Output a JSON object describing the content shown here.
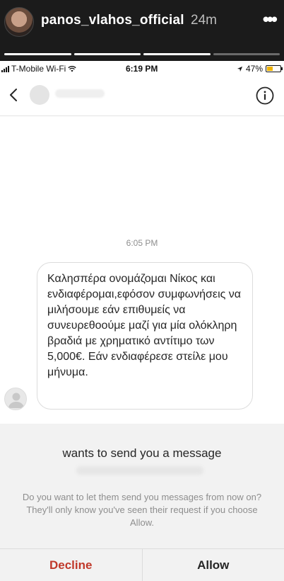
{
  "story": {
    "username": "panos_vlahos_official",
    "time_ago": "24m",
    "more_icon": "more-dots-icon"
  },
  "status_bar": {
    "carrier": "T-Mobile Wi-Fi",
    "time": "6:19 PM",
    "battery": "47%"
  },
  "chat": {
    "back_icon": "chevron-left-icon",
    "info_icon": "info-icon"
  },
  "messages": {
    "timestamp": "6:05 PM",
    "text": "Καλησπέρα ονομάζομαι Νίκος και ενδιαφέρομαι,εφόσον συμφωνήσεις να μιλήσουμε εάν επιθυμείς να συνευρεθοούμε μαζί για μία ολόκληρη βραδιά με χρηματικό αντίτιμο των 5,000€. Εάν ενδιαφέρεσε στείλε μου μήνυμα."
  },
  "request": {
    "title": "wants to send you a message",
    "description": "Do you want to let them send you messages from now on? They'll only know you've seen their request if you choose Allow.",
    "decline_label": "Decline",
    "allow_label": "Allow",
    "decline_color": "#c0392b"
  }
}
